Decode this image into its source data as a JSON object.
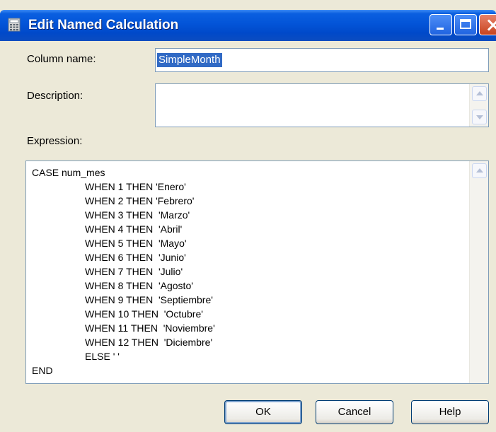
{
  "window": {
    "title": "Edit Named Calculation",
    "icons": {
      "app": "calculator-icon",
      "minimize": "minimize-icon",
      "maximize": "maximize-icon",
      "close": "close-icon"
    }
  },
  "form": {
    "column_name_label": "Column name:",
    "column_name_value": "SimpleMonth",
    "description_label": "Description:",
    "description_value": "",
    "expression_label": "Expression:"
  },
  "expression_lines": [
    "CASE num_mes",
    "WHEN 1 THEN 'Enero'",
    "WHEN 2 THEN 'Febrero'",
    "WHEN 3 THEN  'Marzo'",
    "WHEN 4 THEN  'Abril'",
    "WHEN 5 THEN  'Mayo'",
    "WHEN 6 THEN  'Junio'",
    "WHEN 7 THEN  'Julio'",
    "WHEN 8 THEN  'Agosto'",
    "WHEN 9 THEN  'Septiembre'",
    "WHEN 10 THEN  'Octubre'",
    "WHEN 11 THEN  'Noviembre'",
    "WHEN 12 THEN  'Diciembre'",
    "ELSE ' '",
    "END"
  ],
  "buttons": {
    "ok": "OK",
    "cancel": "Cancel",
    "help": "Help"
  },
  "colors": {
    "titlebar": "#0354d8",
    "dialog_bg": "#ece9d8",
    "selection": "#316ac5",
    "input_border": "#7f9db9"
  }
}
